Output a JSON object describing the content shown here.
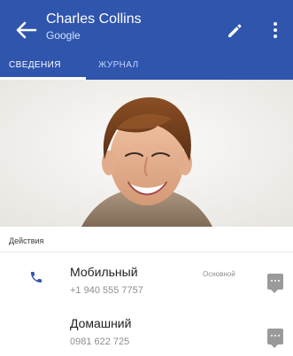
{
  "app_bar": {
    "title": "Charles Collins",
    "subtitle": "Google",
    "accent": "#2f55ad"
  },
  "tabs": [
    {
      "label": "СВЕДЕНИЯ",
      "active": true
    },
    {
      "label": "ЖУРНАЛ",
      "active": false
    }
  ],
  "section": {
    "label": "Действия"
  },
  "phones": [
    {
      "type_label": "Мобильный",
      "number": "+1 940 555 7757",
      "badge": "Основной"
    },
    {
      "type_label": "Домашний",
      "number": "0981 622 725",
      "badge": ""
    }
  ],
  "icons": {
    "back": "back-arrow-icon",
    "edit": "pencil-icon",
    "more": "more-vertical-icon",
    "phone": "phone-icon",
    "message": "message-icon"
  }
}
